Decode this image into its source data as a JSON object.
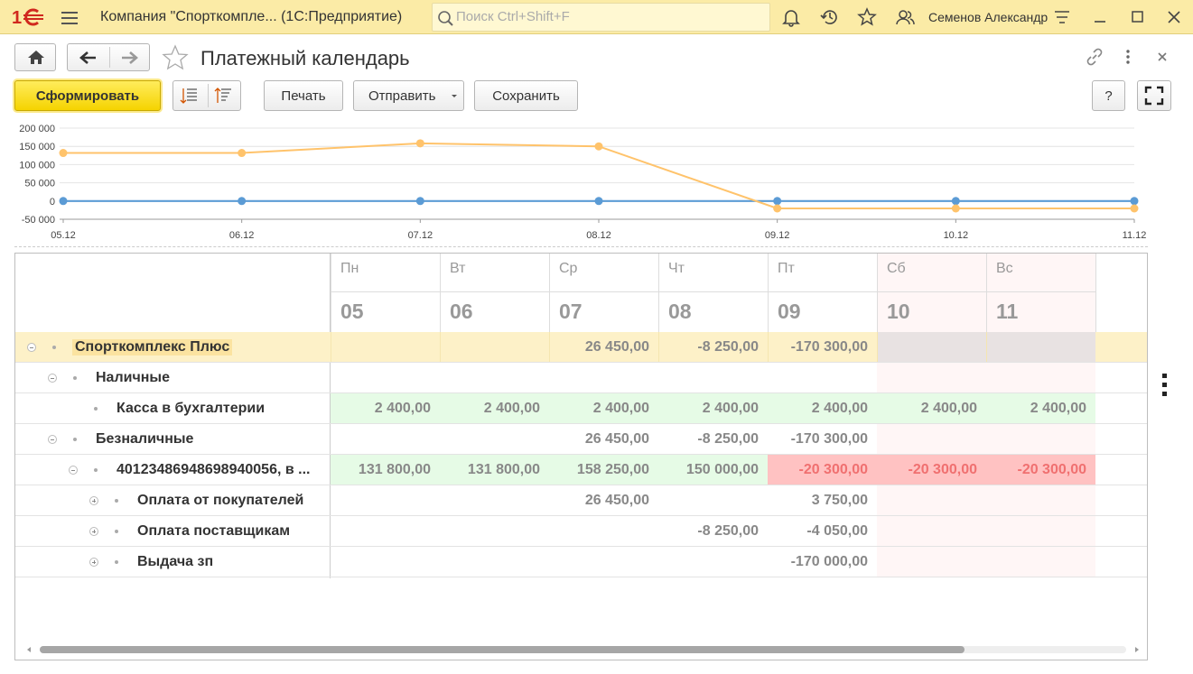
{
  "window": {
    "title": "Компания \"Спорткомпле...  (1С:Предприятие)",
    "search_placeholder": "Поиск Ctrl+Shift+F",
    "user": "Семенов Александр"
  },
  "form": {
    "title": "Платежный календарь"
  },
  "toolbar": {
    "generate": "Сформировать",
    "print": "Печать",
    "send": "Отправить",
    "save": "Сохранить",
    "help": "?"
  },
  "colors": {
    "titlebar": "#fbeba6",
    "series_total": "#ffc36b",
    "series_zero": "#5b9bd5",
    "row_highlight": "#fdf1c8",
    "cell_positive": "#e6fbe6",
    "cell_negative": "#ffc2c2",
    "weekend": "#fff6f6"
  },
  "chart_data": {
    "type": "line",
    "x": [
      "05.12",
      "06.12",
      "07.12",
      "08.12",
      "09.12",
      "10.12",
      "11.12"
    ],
    "yticks": [
      "200 000",
      "150 000",
      "100 000",
      "50 000",
      "0",
      "-50 000"
    ],
    "ylim": [
      -50000,
      200000
    ],
    "series": [
      {
        "values": [
          131800,
          131800,
          158250,
          150000,
          -20300,
          -20300,
          -20300
        ]
      },
      {
        "values": [
          0,
          0,
          0,
          0,
          0,
          0,
          0
        ]
      }
    ]
  },
  "grid": {
    "days": [
      {
        "dow": "Пн",
        "date": "05",
        "weekend": false
      },
      {
        "dow": "Вт",
        "date": "06",
        "weekend": false
      },
      {
        "dow": "Ср",
        "date": "07",
        "weekend": false
      },
      {
        "dow": "Чт",
        "date": "08",
        "weekend": false
      },
      {
        "dow": "Пт",
        "date": "09",
        "weekend": false
      },
      {
        "dow": "Сб",
        "date": "10",
        "weekend": true
      },
      {
        "dow": "Вс",
        "date": "11",
        "weekend": true
      }
    ],
    "rows": [
      {
        "label": "Спорткомплекс Плюс",
        "level": 0,
        "toggle": "minus",
        "style": "company",
        "values": [
          "",
          "",
          "26 450,00",
          "-8 250,00",
          "-170 300,00",
          "",
          ""
        ]
      },
      {
        "label": "Наличные",
        "level": 1,
        "toggle": "minus",
        "style": "plain",
        "values": [
          "",
          "",
          "",
          "",
          "",
          "",
          ""
        ]
      },
      {
        "label": "Касса в бухгалтерии",
        "level": 2,
        "toggle": "",
        "style": "balance",
        "values": [
          "2 400,00",
          "2 400,00",
          "2 400,00",
          "2 400,00",
          "2 400,00",
          "2 400,00",
          "2 400,00"
        ]
      },
      {
        "label": "Безналичные",
        "level": 1,
        "toggle": "minus",
        "style": "plain",
        "values": [
          "",
          "",
          "26 450,00",
          "-8 250,00",
          "-170 300,00",
          "",
          ""
        ]
      },
      {
        "label": "40123486948698940056, в ...",
        "level": 2,
        "toggle": "minus",
        "style": "balance",
        "values": [
          "131 800,00",
          "131 800,00",
          "158 250,00",
          "150 000,00",
          "-20 300,00",
          "-20 300,00",
          "-20 300,00"
        ]
      },
      {
        "label": "Оплата от покупателей",
        "level": 3,
        "toggle": "plus",
        "style": "plain",
        "values": [
          "",
          "",
          "26 450,00",
          "",
          "3 750,00",
          "",
          ""
        ]
      },
      {
        "label": "Оплата поставщикам",
        "level": 3,
        "toggle": "plus",
        "style": "plain",
        "values": [
          "",
          "",
          "",
          "-8 250,00",
          "-4 050,00",
          "",
          ""
        ]
      },
      {
        "label": "Выдача зп",
        "level": 3,
        "toggle": "plus",
        "style": "plain",
        "values": [
          "",
          "",
          "",
          "",
          "-170 000,00",
          "",
          ""
        ]
      }
    ]
  }
}
